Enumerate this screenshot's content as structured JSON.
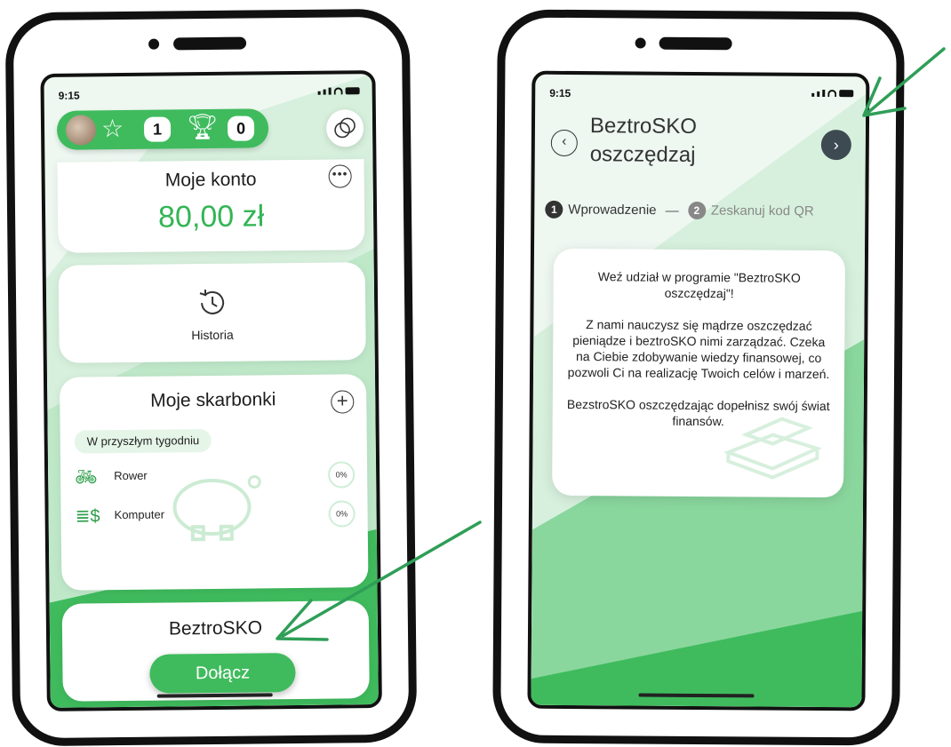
{
  "left_screen": {
    "status_time": "9:15",
    "stars_count": "1",
    "trophy_count": "0",
    "account": {
      "title": "Moje konto",
      "balance": "80,00 zł"
    },
    "history": {
      "label": "Historia"
    },
    "savings": {
      "title": "Moje skarbonki",
      "week_tag": "W przyszłym tygodniu",
      "goals": [
        {
          "name": "Rower",
          "percent": "0%",
          "icon": "bicycle-icon"
        },
        {
          "name": "Komputer",
          "percent": "0%",
          "icon": "money-stack-icon"
        }
      ]
    },
    "sko": {
      "title": "BeztroSKO",
      "join_label": "Dołącz"
    }
  },
  "right_screen": {
    "status_time": "9:15",
    "title_line1": "BeztroSKO",
    "title_line2": "oszczędzaj",
    "steps": [
      {
        "number": "1",
        "label": "Wprowadzenie"
      },
      {
        "number": "2",
        "label": "Zeskanuj kod QR"
      }
    ],
    "step_separator": "—",
    "intro": {
      "paragraph1": "Weź udział w programie \"BeztroSKO oszczędzaj\"!",
      "paragraph2": "Z nami nauczysz się mądrze oszczędzać pieniądze i beztroSKO nimi zarządzać. Czeka na Ciebie zdobywanie wiedzy finansowej, co pozwoli Ci na realizację Twoich celów i marzeń.",
      "paragraph3": "BezstroSKO oszczędzając dopełnisz swój świat finansów."
    }
  },
  "colors": {
    "accent_green": "#3fbb5d",
    "balance_green": "#33b555",
    "arrow_green": "#2f9e57",
    "next_button": "#3e4a52",
    "frame": "#111111"
  }
}
